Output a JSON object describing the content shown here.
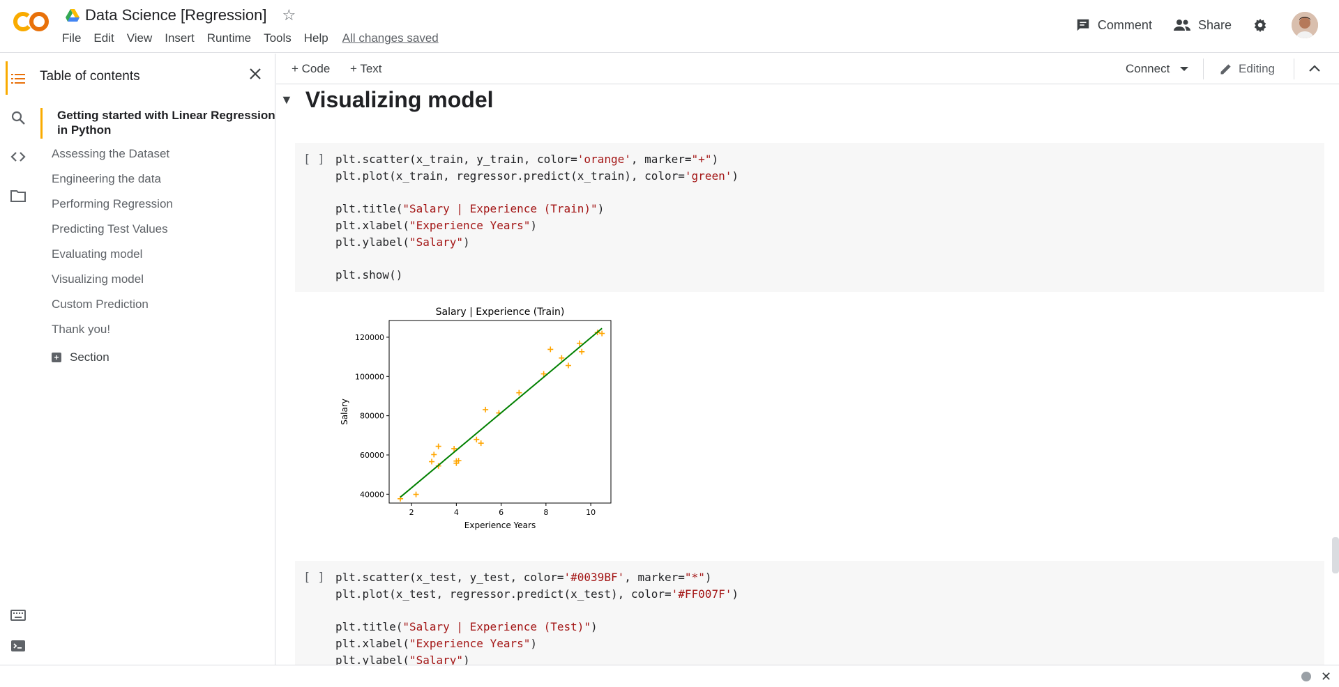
{
  "header": {
    "doc_title": "Data Science [Regression]",
    "menu": [
      "File",
      "Edit",
      "View",
      "Insert",
      "Runtime",
      "Tools",
      "Help"
    ],
    "save_status": "All changes saved",
    "comment_label": "Comment",
    "share_label": "Share"
  },
  "toc": {
    "title": "Table of contents",
    "items": [
      "Getting started with Linear Regression in Python",
      "Assessing the Dataset",
      "Engineering the data",
      "Performing Regression",
      "Predicting Test Values",
      "Evaluating model",
      "Visualizing model",
      "Custom Prediction",
      "Thank you!"
    ],
    "section_label": "Section"
  },
  "toolbar": {
    "code_label": "+ Code",
    "text_label": "+ Text",
    "connect_label": "Connect",
    "editing_label": "Editing"
  },
  "notebook": {
    "heading": "Visualizing model",
    "run_indicator": "[ ]",
    "cell1": {
      "l1a": "plt.scatter(x_train, y_train, color=",
      "l1s": "'orange'",
      "l1b": ", marker=",
      "l1m": "\"+\"",
      "l1c": ")",
      "l2a": "plt.plot(x_train, regressor.predict(x_train), color=",
      "l2s": "'green'",
      "l2c": ")",
      "l3a": "plt.title(",
      "l3s": "\"Salary | Experience (Train)\"",
      "l3c": ")",
      "l4a": "plt.xlabel(",
      "l4s": "\"Experience Years\"",
      "l4c": ")",
      "l5a": "plt.ylabel(",
      "l5s": "\"Salary\"",
      "l5c": ")",
      "l6": "plt.show()"
    },
    "cell2": {
      "l1a": "plt.scatter(x_test, y_test, color=",
      "l1s": "'#0039BF'",
      "l1b": ", marker=",
      "l1m": "\"*\"",
      "l1c": ")",
      "l2a": "plt.plot(x_test, regressor.predict(x_test), color=",
      "l2s": "'#FF007F'",
      "l2c": ")",
      "l3a": "plt.title(",
      "l3s": "\"Salary | Experience (Test)\"",
      "l3c": ")",
      "l4a": "plt.xlabel(",
      "l4s": "\"Experience Years\"",
      "l4c": ")",
      "l5a": "plt.ylabel(",
      "l5s": "\"Salary\"",
      "l5c": ")"
    }
  },
  "colors": {
    "accent": "#f9ab00",
    "scatter": "#ffa500",
    "line": "#008000"
  },
  "chart_data": {
    "type": "scatter",
    "title": "Salary | Experience (Train)",
    "xlabel": "Experience Years",
    "ylabel": "Salary",
    "xlim": [
      1.0,
      10.9
    ],
    "ylim": [
      35500,
      128500
    ],
    "xticks": [
      2,
      4,
      6,
      8,
      10
    ],
    "yticks": [
      40000,
      60000,
      80000,
      100000,
      120000
    ],
    "grid": false,
    "series": [
      {
        "kind": "scatter",
        "color": "#ffa500",
        "marker": "+",
        "points": [
          [
            1.5,
            37700
          ],
          [
            2.2,
            39900
          ],
          [
            2.9,
            56600
          ],
          [
            3.0,
            60200
          ],
          [
            3.2,
            64400
          ],
          [
            3.2,
            54400
          ],
          [
            3.9,
            63200
          ],
          [
            4.0,
            55800
          ],
          [
            4.1,
            57100
          ],
          [
            4.0,
            56900
          ],
          [
            4.9,
            67900
          ],
          [
            5.1,
            66000
          ],
          [
            5.3,
            83100
          ],
          [
            5.9,
            81400
          ],
          [
            6.8,
            91700
          ],
          [
            7.9,
            101300
          ],
          [
            8.2,
            113800
          ],
          [
            8.7,
            109400
          ],
          [
            9.0,
            105600
          ],
          [
            9.5,
            116900
          ],
          [
            9.6,
            112600
          ],
          [
            10.3,
            122400
          ],
          [
            10.5,
            121900
          ]
        ]
      },
      {
        "kind": "line",
        "color": "#008000",
        "points": [
          [
            1.5,
            38500
          ],
          [
            10.5,
            124500
          ]
        ]
      }
    ]
  }
}
